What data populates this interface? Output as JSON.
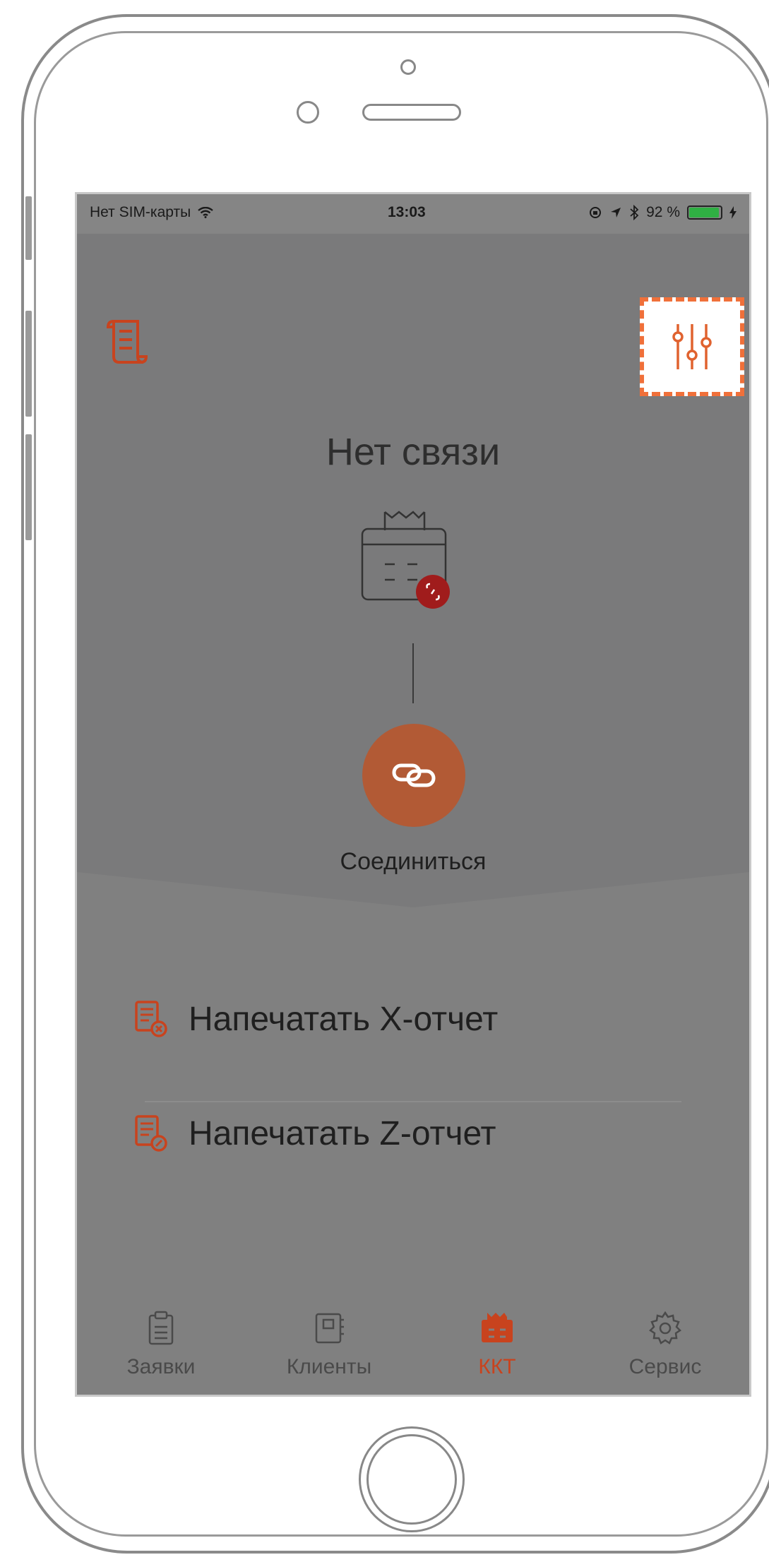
{
  "status_bar": {
    "carrier": "Нет SIM-карты",
    "time": "13:03",
    "battery_percent": "92 %"
  },
  "header": {
    "connection_status": "Нет связи"
  },
  "connect": {
    "label": "Соединиться"
  },
  "menu": {
    "items": [
      {
        "label": "Напечатать X-отчет"
      },
      {
        "label": "Напечатать Z-отчет"
      }
    ]
  },
  "tabs": [
    {
      "label": "Заявки",
      "icon": "clipboard-icon"
    },
    {
      "label": "Клиенты",
      "icon": "address-book-icon"
    },
    {
      "label": "ККТ",
      "icon": "cash-register-icon",
      "active": true
    },
    {
      "label": "Сервис",
      "icon": "gear-icon"
    }
  ],
  "colors": {
    "accent": "#c8431e",
    "highlight_border": "#f0703a",
    "screen_overlay": "#7a7a7b",
    "error_badge": "#a01c1c"
  }
}
